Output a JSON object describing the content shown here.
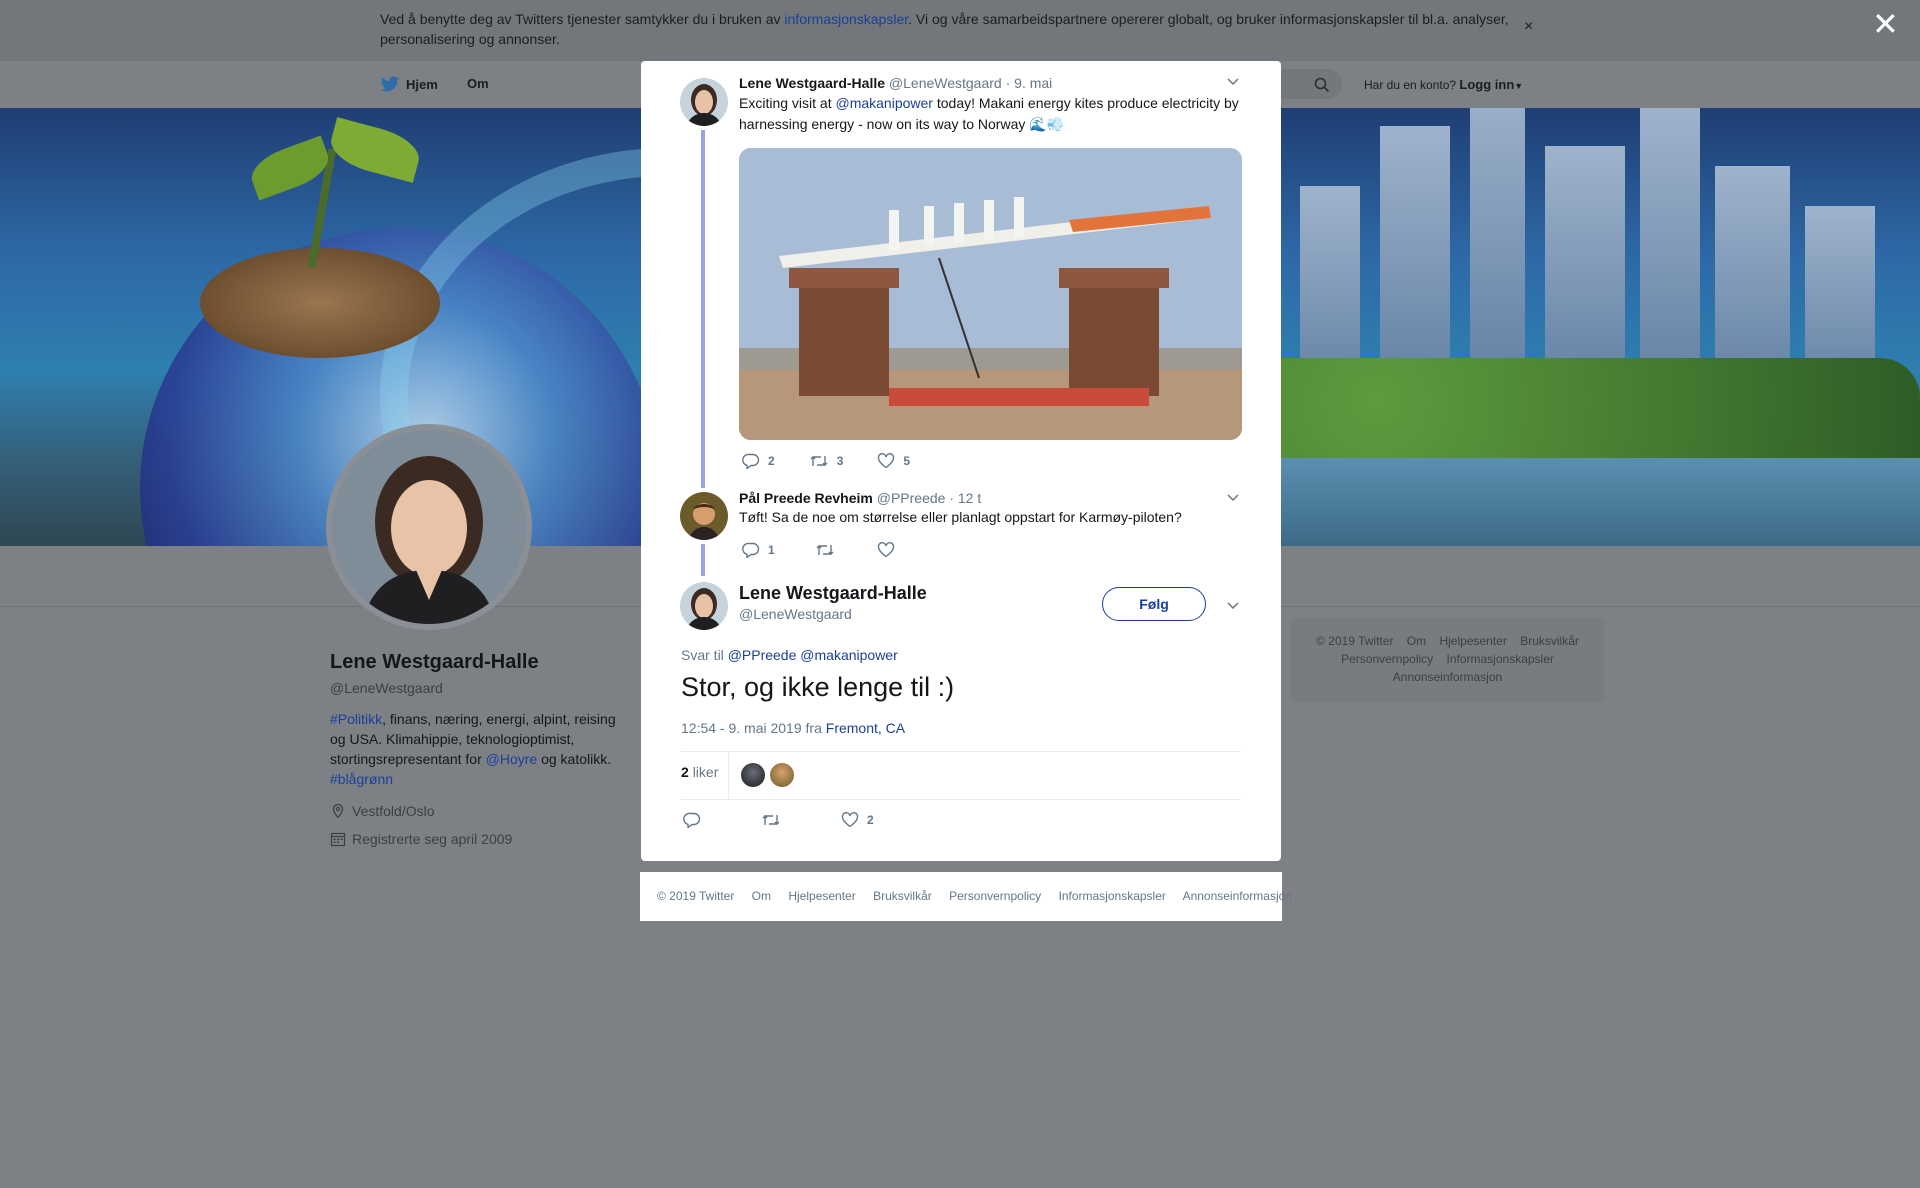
{
  "cookie": {
    "text_before": "Ved å benytte deg av Twitters tjenester samtykker du i bruken av ",
    "link": "informasjonskapsler",
    "text_after": ". Vi og våre samarbeidspartnere opererer globalt, og bruker informasjonskapsler til bl.a. analyser, personalisering og annonser.",
    "close": "×"
  },
  "overlay_close": "✕",
  "nav": {
    "home": "Hjem",
    "about": "Om",
    "account_prompt": "Har du en konto?",
    "login": "Logg inn"
  },
  "profile": {
    "name": "Lene Westgaard-Halle",
    "handle": "@LeneWestgaard",
    "bio": {
      "hashtag1": "#Politikk",
      "text1": ", finans, næring, energi, alpint, reising og USA. Klimahippie, teknologioptimist, stortingsrepresentant for ",
      "mention": "@Hoyre",
      "text2": " og katolikk. ",
      "hashtag2": "#blågrønn"
    },
    "location": "Vestfold/Oslo",
    "joined": "Registrerte seg april 2009"
  },
  "side_footer": [
    "© 2019 Twitter",
    "Om",
    "Hjelpesenter",
    "Bruksvilkår",
    "Personvernpolicy",
    "Informasjonskapsler",
    "Annonseinformasjon"
  ],
  "tweet1": {
    "name": "Lene Westgaard-Halle",
    "handle": "@LeneWestgaard",
    "time": "· 9. mai",
    "text_before": "Exciting visit at ",
    "mention": "@makanipower",
    "text_after": " today! Makani energy kites produce electricity by harnessing energy - now on its way to Norway 🌊💨",
    "replies": "2",
    "retweets": "3",
    "likes": "5"
  },
  "tweet2": {
    "name": "Pål Preede Revheim",
    "handle": "@PPreede",
    "time": "· 12 t",
    "text": "Tøft! Sa de noe om størrelse eller planlagt oppstart for Karmøy-piloten?",
    "replies": "1"
  },
  "main_tweet": {
    "name": "Lene Westgaard-Halle",
    "handle": "@LeneWestgaard",
    "follow": "Følg",
    "reply_to_label": "Svar til",
    "reply_to_1": "@PPreede",
    "reply_to_2": "@makanipower",
    "text": "Stor, og ikke lenge til :)",
    "timestamp": "12:54 - 9. mai 2019 fra",
    "location": "Fremont, CA",
    "like_count": "2",
    "like_label": "liker",
    "likes_action": "2"
  },
  "bottom_footer": [
    "© 2019 Twitter",
    "Om",
    "Hjelpesenter",
    "Bruksvilkår",
    "Personvernpolicy",
    "Informasjonskapsler",
    "Annonseinformasjon"
  ]
}
